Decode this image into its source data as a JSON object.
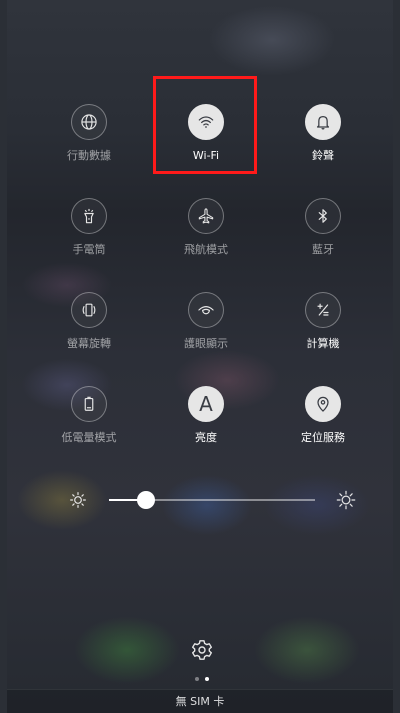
{
  "quick_settings": [
    {
      "label": "行動數據",
      "icon": "globe-icon",
      "active": false
    },
    {
      "label": "Wi-Fi",
      "icon": "wifi-icon",
      "active": true
    },
    {
      "label": "鈴聲",
      "icon": "bell-icon",
      "active": true
    },
    {
      "label": "手電筒",
      "icon": "flashlight-icon",
      "active": false
    },
    {
      "label": "飛航模式",
      "icon": "airplane-icon",
      "active": false
    },
    {
      "label": "藍牙",
      "icon": "bluetooth-icon",
      "active": false
    },
    {
      "label": "螢幕旋轉",
      "icon": "screen-rotation-icon",
      "active": false
    },
    {
      "label": "護眼顯示",
      "icon": "eye-comfort-icon",
      "active": false
    },
    {
      "label": "計算機",
      "icon": "calculator-icon",
      "active": false
    },
    {
      "label": "低電量模式",
      "icon": "battery-icon",
      "active": false
    },
    {
      "label": "亮度",
      "icon": "auto-brightness-icon",
      "icon_text": "A",
      "active": true
    },
    {
      "label": "定位服務",
      "icon": "location-icon",
      "active": true
    }
  ],
  "brightness": {
    "level": 0.18,
    "min_icon": "sun-small-icon",
    "max_icon": "sun-large-icon"
  },
  "footer": {
    "settings_icon": "gear-icon",
    "page_count": 2,
    "current_page": 1
  },
  "status_bar": {
    "carrier_text": "無 SIM 卡"
  },
  "colors": {
    "active_circle": "#e6e6e6",
    "highlight_box": "#ff1a1a"
  }
}
